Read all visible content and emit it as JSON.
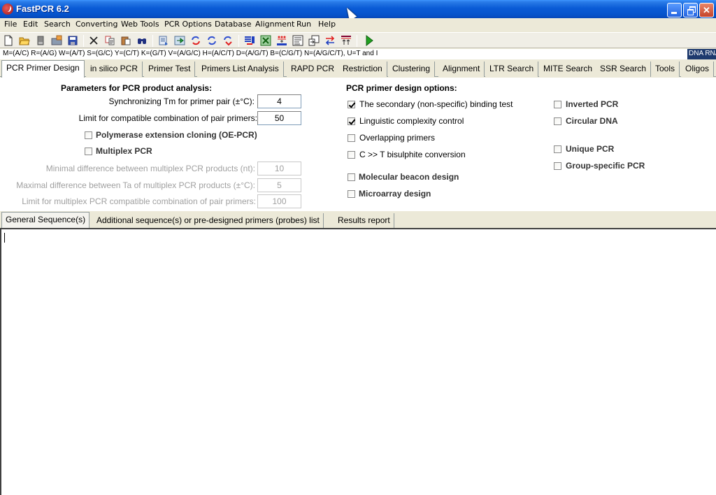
{
  "window": {
    "title": "FastPCR 6.2",
    "controls": {
      "minimize": "minimize",
      "maximize": "restore",
      "close": "close"
    }
  },
  "menu": {
    "items": [
      "File",
      "Edit",
      "Search",
      "Converting",
      "Web Tools",
      "PCR Options",
      "Database",
      "Alignment",
      "Run",
      "Help"
    ]
  },
  "toolbar": {
    "icons": [
      "new-document",
      "open-folder",
      "disk-drive",
      "folder-open-2",
      "save",
      "delete",
      "copy",
      "paste",
      "find",
      "properties",
      "import",
      "refresh-red",
      "refresh-blue",
      "redo-red",
      "list-export",
      "excel-export",
      "sequence-map",
      "text-view",
      "export-window",
      "swap-arrows",
      "primers-align",
      "run"
    ]
  },
  "codeline": {
    "text": "M=(A/C) R=(A/G) W=(A/T) S=(G/C) Y=(C/T) K=(G/T) V=(A/G/C) H=(A/C/T) D=(A/G/T) B=(C/G/T) N=(A/G/C/T), U=T and I",
    "badge": "DNA RNA"
  },
  "tabs": [
    {
      "label": "PCR Primer Design",
      "active": true
    },
    {
      "label": "in silico PCR"
    },
    {
      "label": "Primer Test"
    },
    {
      "label": "Primers List Analysis"
    },
    {
      "label": "RAPD PCR"
    },
    {
      "label": "Restriction"
    },
    {
      "label": "Clustering"
    },
    {
      "label": "Alignment"
    },
    {
      "label": "LTR Search"
    },
    {
      "label": "MITE Search"
    },
    {
      "label": "SSR Search"
    },
    {
      "label": "Tools"
    },
    {
      "label": "Oligos"
    }
  ],
  "params": {
    "heading": "Parameters for PCR product analysis:",
    "sync_tm_label": "Synchronizing Tm for primer pair (±°C):",
    "sync_tm_value": "4",
    "limit_pairs_label": "Limit for compatible combination of pair primers:",
    "limit_pairs_value": "50",
    "oe_pcr_label": "Polymerase extension cloning (OE-PCR)",
    "oe_pcr_checked": false,
    "multiplex_label": "Multiplex PCR",
    "multiplex_checked": false,
    "min_diff_label": "Minimal difference between multiplex PCR products (nt):",
    "min_diff_value": "10",
    "max_ta_label": "Maximal difference between Ta of multiplex PCR products (±°C):",
    "max_ta_value": "5",
    "multiplex_limit_label": "Limit for multiplex PCR compatible combination of pair primers:",
    "multiplex_limit_value": "100"
  },
  "design_options": {
    "heading": "PCR primer design options:",
    "left": [
      {
        "label": "The secondary (non-specific) binding test",
        "checked": true
      },
      {
        "label": "Linguistic complexity control",
        "checked": true
      },
      {
        "label": "Overlapping primers",
        "checked": false
      },
      {
        "label": "C >> T bisulphite conversion",
        "checked": false
      },
      {
        "label": "Molecular beacon design",
        "checked": false
      },
      {
        "label": "Microarray design",
        "checked": false
      }
    ],
    "right": [
      {
        "label": "Inverted PCR",
        "checked": false
      },
      {
        "label": "Circular DNA",
        "checked": false
      },
      {
        "label": "Unique PCR",
        "checked": false
      },
      {
        "label": "Group-specific PCR",
        "checked": false
      }
    ]
  },
  "subtabs": [
    {
      "label": "General Sequence(s)",
      "active": true
    },
    {
      "label": "Additional sequence(s) or pre-designed primers (probes) list"
    },
    {
      "label": "Results report"
    }
  ],
  "editor": {
    "value": ""
  }
}
